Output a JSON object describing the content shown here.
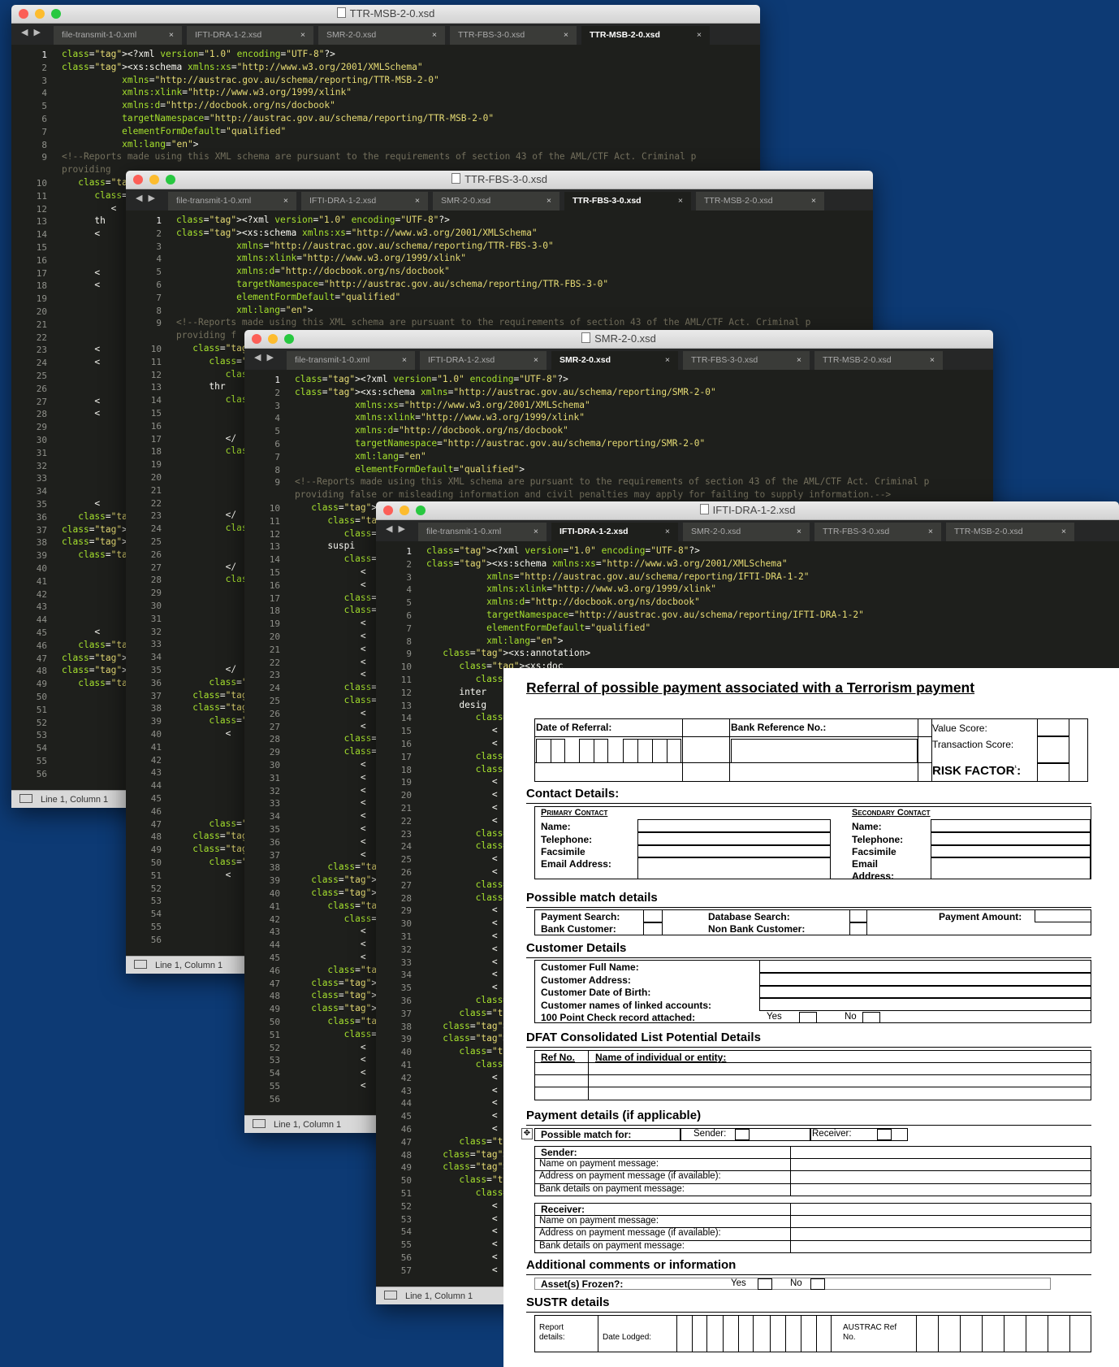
{
  "windows": [
    {
      "id": "w1",
      "title": "TTR-MSB-2-0.xsd",
      "tabs": [
        "file-transmit-1-0.xml",
        "IFTI-DRA-1-2.xsd",
        "SMR-2-0.xsd",
        "TTR-FBS-3-0.xsd",
        "TTR-MSB-2-0.xsd"
      ],
      "active_tab": 4,
      "status": "Line 1, Column 1",
      "line_numbers": [
        "1",
        "2",
        "3",
        "4",
        "5",
        "6",
        "7",
        "8",
        "9",
        "",
        "10",
        "11",
        "12",
        "13",
        "14",
        "15",
        "16",
        "17",
        "18",
        "19",
        "20",
        "21",
        "22",
        "23",
        "24",
        "25",
        "26",
        "27",
        "28",
        "29",
        "30",
        "31",
        "32",
        "33",
        "34",
        "35",
        "36",
        "37",
        "38",
        "39",
        "40",
        "41",
        "42",
        "43",
        "44",
        "45",
        "46",
        "47",
        "48",
        "49",
        "50",
        "51",
        "52",
        "53",
        "54",
        "55",
        "56"
      ],
      "code": [
        "<?xml version=\"1.0\" encoding=\"UTF-8\"?>",
        "<xs:schema xmlns:xs=\"http://www.w3.org/2001/XMLSchema\"",
        "           xmlns=\"http://austrac.gov.au/schema/reporting/TTR-MSB-2-0\"",
        "           xmlns:xlink=\"http://www.w3.org/1999/xlink\"",
        "           xmlns:d=\"http://docbook.org/ns/docbook\"",
        "           targetNamespace=\"http://austrac.gov.au/schema/reporting/TTR-MSB-2-0\"",
        "           elementFormDefault=\"qualified\"",
        "           xml:lang=\"en\">",
        "<!--Reports made using this XML schema are pursuant to the requirements of section 43 of the AML/CTF Act. Criminal p",
        "providing",
        "   <xs:ann",
        "      <xs:",
        "         <",
        "      th",
        "      <",
        "",
        "",
        "      <",
        "      <",
        "",
        "",
        "",
        "",
        "      <",
        "      <",
        "",
        "",
        "      <",
        "      <",
        "",
        "",
        "",
        "",
        "",
        "",
        "      <",
        "   </xs",
        "</xs:an",
        "<xs:ele",
        "   <xs:",
        "",
        "",
        "",
        "",
        "",
        "      <",
        "   </xs",
        "</xs:el",
        "<xs:ele",
        "   <xs:",
        "",
        "",
        "",
        "",
        "",
        ""
      ]
    },
    {
      "id": "w2",
      "title": "TTR-FBS-3-0.xsd",
      "tabs": [
        "file-transmit-1-0.xml",
        "IFTI-DRA-1-2.xsd",
        "SMR-2-0.xsd",
        "TTR-FBS-3-0.xsd",
        "TTR-MSB-2-0.xsd"
      ],
      "active_tab": 3,
      "status": "Line 1, Column 1",
      "line_numbers": [
        "1",
        "2",
        "3",
        "4",
        "5",
        "6",
        "7",
        "8",
        "9",
        "",
        "10",
        "11",
        "12",
        "13",
        "14",
        "15",
        "16",
        "17",
        "18",
        "19",
        "20",
        "21",
        "22",
        "23",
        "24",
        "25",
        "26",
        "27",
        "28",
        "29",
        "30",
        "31",
        "32",
        "33",
        "34",
        "35",
        "36",
        "37",
        "38",
        "39",
        "40",
        "41",
        "42",
        "43",
        "44",
        "45",
        "46",
        "47",
        "48",
        "49",
        "50",
        "51",
        "52",
        "53",
        "54",
        "55",
        "56"
      ],
      "code": [
        "<?xml version=\"1.0\" encoding=\"UTF-8\"?>",
        "<xs:schema xmlns:xs=\"http://www.w3.org/2001/XMLSchema\"",
        "           xmlns=\"http://austrac.gov.au/schema/reporting/TTR-FBS-3-0\"",
        "           xmlns:xlink=\"http://www.w3.org/1999/xlink\"",
        "           xmlns:d=\"http://docbook.org/ns/docbook\"",
        "           targetNamespace=\"http://austrac.gov.au/schema/reporting/TTR-FBS-3-0\"",
        "           elementFormDefault=\"qualified\"",
        "           xml:lang=\"en\">",
        "<!--Reports made using this XML schema are pursuant to the requirements of section 43 of the AML/CTF Act. Criminal p",
        "providing f",
        "   <xs:anno",
        "      <xs:d",
        "         <d",
        "      thr",
        "         <d",
        "",
        "",
        "         </",
        "         <d",
        "",
        "",
        "",
        "",
        "         </",
        "         <d",
        "",
        "",
        "         </",
        "         <d",
        "",
        "",
        "",
        "",
        "",
        "",
        "         </",
        "      </xs:",
        "   </xs:ann",
        "   <xs:elem",
        "      <xs:c",
        "         <",
        "",
        "",
        "",
        "",
        "",
        "",
        "      </xs",
        "   </xs:ele",
        "   <xs:elem",
        "      <xs:c",
        "         <",
        "",
        "",
        "",
        ""
      ]
    },
    {
      "id": "w3",
      "title": "SMR-2-0.xsd",
      "tabs": [
        "file-transmit-1-0.xml",
        "IFTI-DRA-1-2.xsd",
        "SMR-2-0.xsd",
        "TTR-FBS-3-0.xsd",
        "TTR-MSB-2-0.xsd"
      ],
      "active_tab": 2,
      "status": "Line 1, Column 1",
      "line_numbers": [
        "1",
        "2",
        "3",
        "4",
        "5",
        "6",
        "7",
        "8",
        "9",
        "",
        "10",
        "11",
        "12",
        "13",
        "14",
        "15",
        "16",
        "17",
        "18",
        "19",
        "20",
        "21",
        "22",
        "23",
        "24",
        "25",
        "26",
        "27",
        "28",
        "29",
        "30",
        "31",
        "32",
        "33",
        "34",
        "35",
        "36",
        "37",
        "38",
        "39",
        "40",
        "41",
        "42",
        "43",
        "44",
        "45",
        "46",
        "47",
        "48",
        "49",
        "50",
        "51",
        "52",
        "53",
        "54",
        "55",
        "56"
      ],
      "code": [
        "<?xml version=\"1.0\" encoding=\"UTF-8\"?>",
        "<xs:schema xmlns=\"http://austrac.gov.au/schema/reporting/SMR-2-0\"",
        "           xmlns:xs=\"http://www.w3.org/2001/XMLSchema\"",
        "           xmlns:xlink=\"http://www.w3.org/1999/xlink\"",
        "           xmlns:d=\"http://docbook.org/ns/docbook\"",
        "           targetNamespace=\"http://austrac.gov.au/schema/reporting/SMR-2-0\"",
        "           xml:lang=\"en\"",
        "           elementFormDefault=\"qualified\">",
        "<!--Reports made using this XML schema are pursuant to the requirements of section 43 of the AML/CTF Act. Criminal p",
        "providing false or misleading information and civil penalties may apply for failing to supply information.-->",
        "   <xs:annota",
        "      <xs:doc",
        "         <d:t",
        "      suspi",
        "         <d:a",
        "            <",
        "            <",
        "         </d:",
        "         <d:r",
        "            <",
        "            <",
        "            <",
        "            <",
        "            <",
        "         </d:",
        "         <d:c",
        "            <",
        "            <",
        "         </d:",
        "         <d:k",
        "            <",
        "            <",
        "            <",
        "            <",
        "            <",
        "            <",
        "            <",
        "            <",
        "      </xs:do",
        "   </xs:annot",
        "   <xs:elemen",
        "      <xs:com",
        "         <xs:",
        "            <",
        "            <",
        "            <",
        "      </xs",
        "   </xs:co",
        "   </xs:eleme",
        "   <xs:elemen",
        "      <xs:com",
        "         <xs:",
        "            <",
        "            <",
        "            <",
        "            <"
      ]
    },
    {
      "id": "w4",
      "title": "IFTI-DRA-1-2.xsd",
      "tabs": [
        "file-transmit-1-0.xml",
        "IFTI-DRA-1-2.xsd",
        "SMR-2-0.xsd",
        "TTR-FBS-3-0.xsd",
        "TTR-MSB-2-0.xsd"
      ],
      "active_tab": 1,
      "status": "Line 1, Column 1",
      "line_numbers": [
        "1",
        "2",
        "3",
        "4",
        "5",
        "6",
        "7",
        "8",
        "9",
        "10",
        "11",
        "12",
        "13",
        "14",
        "15",
        "16",
        "17",
        "18",
        "19",
        "20",
        "21",
        "22",
        "23",
        "24",
        "25",
        "26",
        "27",
        "28",
        "29",
        "30",
        "31",
        "32",
        "33",
        "34",
        "35",
        "36",
        "37",
        "38",
        "39",
        "40",
        "41",
        "42",
        "43",
        "44",
        "45",
        "46",
        "47",
        "48",
        "49",
        "50",
        "51",
        "52",
        "53",
        "54",
        "55",
        "56",
        "57"
      ],
      "code": [
        "<?xml version=\"1.0\" encoding=\"UTF-8\"?>",
        "<xs:schema xmlns:xs=\"http://www.w3.org/2001/XMLSchema\"",
        "           xmlns=\"http://austrac.gov.au/schema/reporting/IFTI-DRA-1-2\"",
        "           xmlns:xlink=\"http://www.w3.org/1999/xlink\"",
        "           xmlns:d=\"http://docbook.org/ns/docbook\"",
        "           targetNamespace=\"http://austrac.gov.au/schema/reporting/IFTI-DRA-1-2\"",
        "           elementFormDefault=\"qualified\"",
        "           xml:lang=\"en\">",
        "   <xs:annotation>",
        "      <xs:doc",
        "         <d:t",
        "      inter",
        "      desig",
        "         <d:a",
        "            <",
        "            <",
        "         </d:",
        "         <d:r",
        "            <",
        "            <",
        "            <",
        "            <",
        "         </d:",
        "         <d:c",
        "            <",
        "            <",
        "         </d:",
        "         <d:k",
        "            <",
        "            <",
        "            <",
        "            <",
        "            <",
        "            <",
        "            <",
        "         </d:",
        "      </xs:do",
        "   </xs:annota",
        "   <xs:element",
        "      <xs:comp",
        "         <xs:",
        "            <",
        "            <",
        "            <",
        "            <",
        "            <",
        "      </xs",
        "   </xs:eleme",
        "   <xs:element",
        "      <xs:comp",
        "         <xs:",
        "            <",
        "            <",
        "            <",
        "            <",
        "            <",
        "            <"
      ]
    }
  ],
  "form": {
    "title": "Referral of possible payment associated with a Terrorism payment",
    "header": {
      "date_label": "Date of Referral:",
      "bank_ref_label": "Bank Reference No.:",
      "value_score_label": "Value Score:",
      "transaction_score_label": "Transaction Score:",
      "risk_factor_label": "RISK FACTOR",
      "risk_factor_sup": "¹",
      "risk_factor_colon": ":"
    },
    "contact": {
      "heading": "Contact Details:",
      "primary_heading": "Primary Contact",
      "secondary_heading": "Secondary Contact",
      "primary_fields": [
        "Name:",
        "Telephone:",
        "Facsimile",
        "Email Address:"
      ],
      "secondary_fields": [
        "Name:",
        "Telephone:",
        "Facsimile",
        "Email",
        "Address:"
      ]
    },
    "match": {
      "heading": "Possible match details",
      "payment_search": "Payment Search:",
      "bank_customer": "Bank Customer:",
      "database_search": "Database Search:",
      "non_bank_customer": "Non Bank Customer:",
      "payment_amount": "Payment Amount:"
    },
    "customer": {
      "heading": "Customer Details",
      "fields": [
        "Customer Full Name:",
        "Customer Address:",
        "Customer Date of Birth:",
        "Customer names of linked accounts:",
        "100 Point Check record attached:"
      ],
      "yes": "Yes",
      "no": "No"
    },
    "dfat": {
      "heading": "DFAT Consolidated List Potential Details",
      "col_ref": "Ref No.",
      "col_name": "Name of individual or entity:"
    },
    "payment": {
      "heading": "Payment details (if applicable)",
      "possible_match_for": "Possible match for:",
      "sender_label": "Sender:",
      "receiver_label": "Receiver:",
      "sender_heading": "Sender:",
      "receiver_heading": "Receiver:",
      "rows": [
        "Name on payment message:",
        "Address on payment message (if available):",
        "Bank details on payment message:"
      ]
    },
    "additional": {
      "heading": "Additional comments or information",
      "assets_frozen": "Asset(s) Frozen?:",
      "yes": "Yes",
      "no": "No"
    },
    "sustr": {
      "heading": "SUSTR details",
      "report_details": "Report details:",
      "date_lodged": "Date Lodged:",
      "austrac_ref": "AUSTRAC Ref No."
    }
  },
  "icons": [
    "close-icon",
    "document-icon",
    "screen-icon",
    "move-handle-icon",
    "nav-arrows-icon"
  ]
}
